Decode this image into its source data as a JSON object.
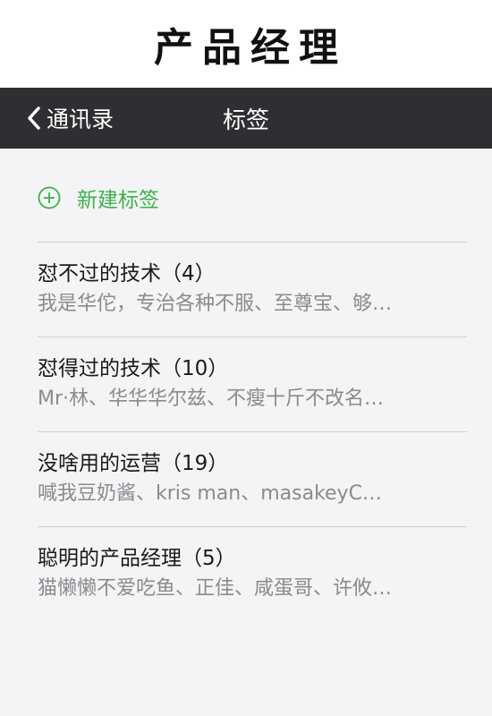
{
  "caption": "产品经理",
  "navbar": {
    "back_label": "通讯录",
    "title": "标签"
  },
  "new_tag": {
    "label": "新建标签"
  },
  "tags": [
    {
      "title": "怼不过的技术（4）",
      "members": "我是华佗，专治各种不服、至尊宝、够…"
    },
    {
      "title": "怼得过的技术（10）",
      "members": "Mr·林、华华华尔兹、不瘦十斤不改名…"
    },
    {
      "title": "没啥用的运营（19）",
      "members": "喊我豆奶酱、kris man、masakeyC…"
    },
    {
      "title": "聪明的产品经理（5）",
      "members": "猫懒懒不爱吃鱼、正佳、咸蛋哥、许攸…"
    }
  ],
  "colors": {
    "navbar": "#2f2f33",
    "accent_green": "#3db04c",
    "background": "#f4f4f6"
  },
  "icons": {
    "back": "chevron-left-icon",
    "add": "plus-circle-icon"
  }
}
